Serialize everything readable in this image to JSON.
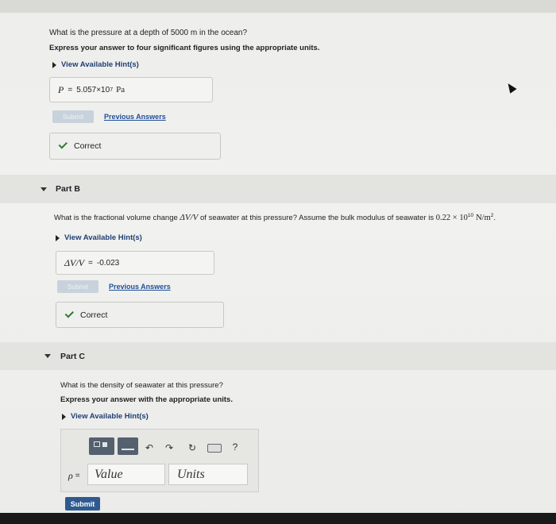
{
  "partA": {
    "question": "What is the pressure at a depth of 5000 m in the ocean?",
    "instruction": "Express your answer to four significant figures using the appropriate units.",
    "hint_label": "View Available Hint(s)",
    "answer_var": "P",
    "answer_eq": "=",
    "answer_mantissa": "5.057×10",
    "answer_exp": "7",
    "answer_unit": "Pa",
    "submit_label": "Submit",
    "previous_label": "Previous Answers",
    "feedback": "Correct"
  },
  "partB": {
    "title": "Part B",
    "question_pre": "What is the fractional volume change ",
    "question_var": "ΔV/V",
    "question_mid": " of seawater at this pressure? Assume the bulk modulus of seawater is ",
    "bulk_value": "0.22 × 10",
    "bulk_exp": "10",
    "bulk_unit": "N/m",
    "bulk_unit_exp": "2",
    "question_end": ".",
    "hint_label": "View Available Hint(s)",
    "answer_var": "ΔV/V",
    "answer_eq": "=",
    "answer_value": "-0.023",
    "submit_label": "Submit",
    "previous_label": "Previous Answers",
    "feedback": "Correct"
  },
  "partC": {
    "title": "Part C",
    "question": "What is the density of seawater at this pressure?",
    "instruction": "Express your answer with the appropriate units.",
    "hint_label": "View Available Hint(s)",
    "answer_var": "ρ",
    "answer_eq": "=",
    "value_placeholder": "Value",
    "units_placeholder": "Units",
    "help_label": "?",
    "submit_label": "Submit"
  }
}
